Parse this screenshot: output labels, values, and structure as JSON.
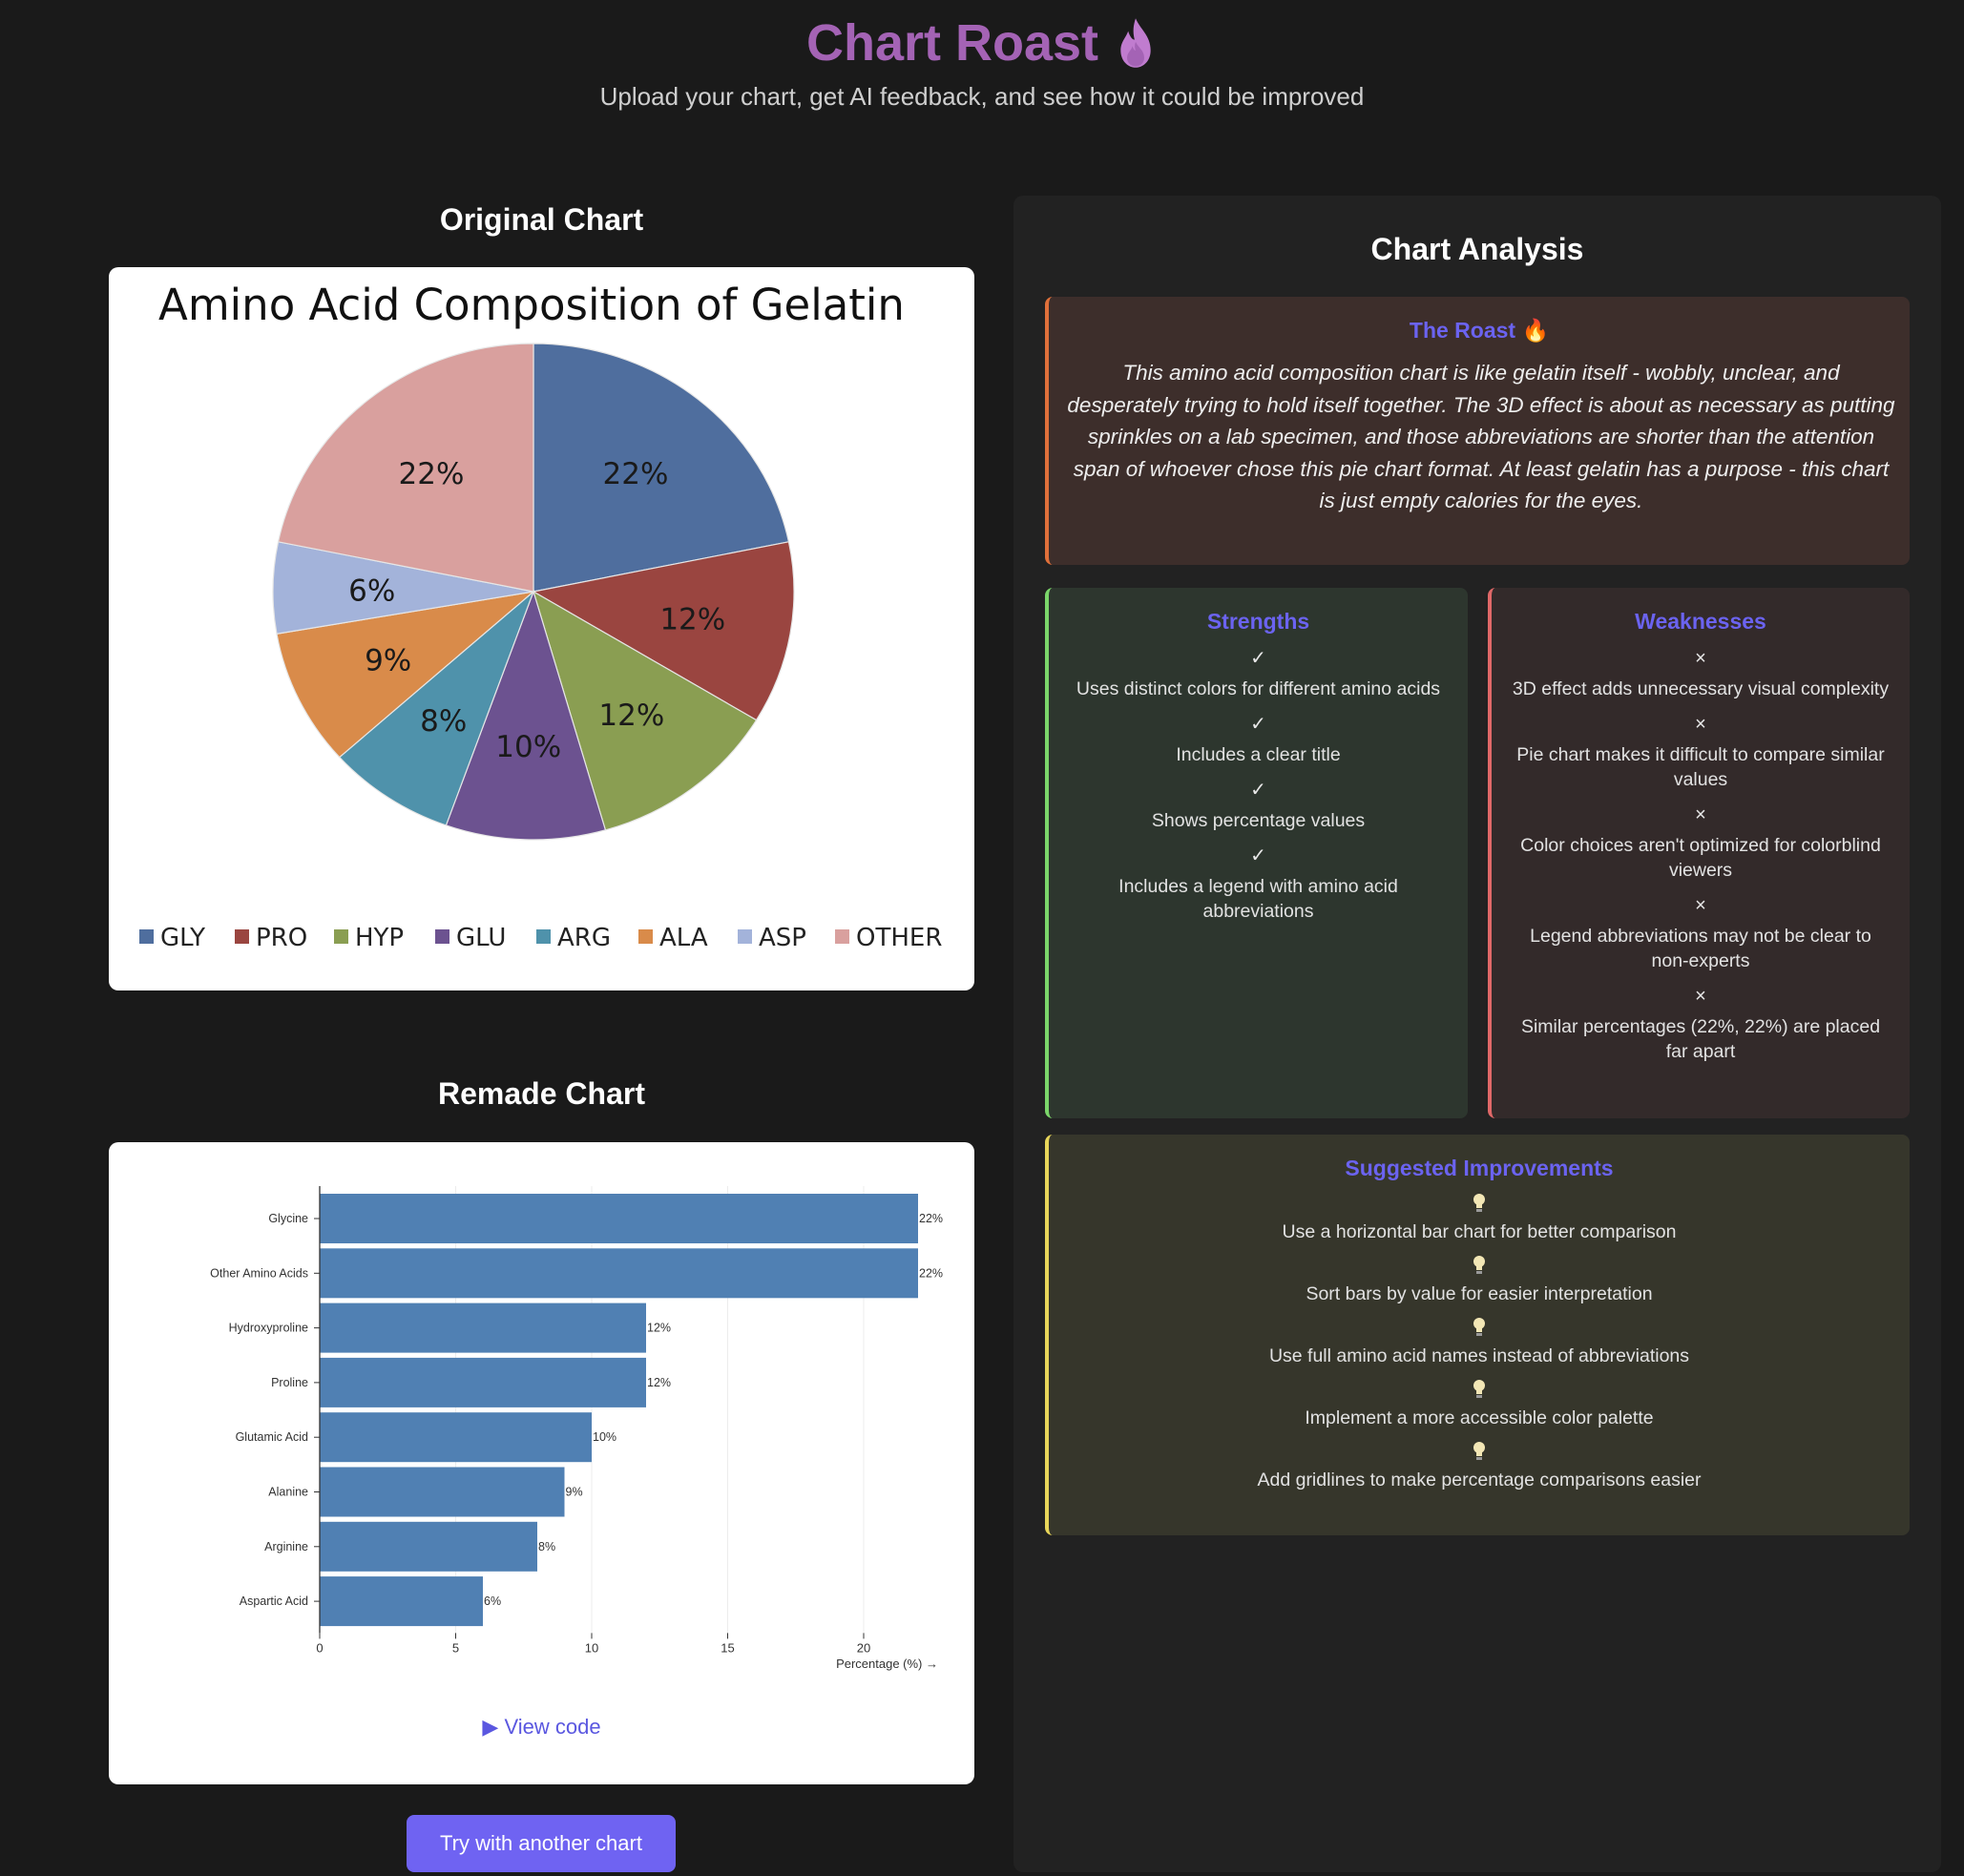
{
  "header": {
    "title": "Chart Roast",
    "subtitle": "Upload your chart, get AI feedback, and see how it could be improved"
  },
  "original": {
    "section_title": "Original Chart",
    "chart_title": "Amino Acid Composition of Gelatin",
    "legend": [
      "GLY",
      "PRO",
      "HYP",
      "GLU",
      "ARG",
      "ALA",
      "ASP",
      "OTHER"
    ]
  },
  "remade": {
    "section_title": "Remade Chart",
    "view_code": "▶ View code",
    "xlabel": "Percentage (%) →"
  },
  "try_button": "Try with another chart",
  "analysis": {
    "title": "Chart Analysis",
    "roast_title": "The Roast 🔥",
    "roast_text": "This amino acid composition chart is like gelatin itself - wobbly, unclear, and desperately trying to hold itself together. The 3D effect is about as necessary as putting sprinkles on a lab specimen, and those abbreviations are shorter than the attention span of whoever chose this pie chart format. At least gelatin has a purpose - this chart is just empty calories for the eyes.",
    "strengths_title": "Strengths",
    "strength_mark": "✓",
    "strengths": [
      "Uses distinct colors for different amino acids",
      "Includes a clear title",
      "Shows percentage values",
      "Includes a legend with amino acid abbreviations"
    ],
    "weaknesses_title": "Weaknesses",
    "weakness_mark": "×",
    "weaknesses": [
      "3D effect adds unnecessary visual complexity",
      "Pie chart makes it difficult to compare similar values",
      "Color choices aren't optimized for colorblind viewers",
      "Legend abbreviations may not be clear to non-experts",
      "Similar percentages (22%, 22%) are placed far apart"
    ],
    "improvements_title": "Suggested Improvements",
    "improvements": [
      "Use a horizontal bar chart for better comparison",
      "Sort bars by value for easier interpretation",
      "Use full amino acid names instead of abbreviations",
      "Implement a more accessible color palette",
      "Add gridlines to make percentage comparisons easier"
    ]
  },
  "colors": {
    "accent": "#6f63f2",
    "title": "#a463b5",
    "bar": "#5080b3"
  },
  "chart_data": [
    {
      "type": "pie",
      "title": "Amino Acid Composition of Gelatin",
      "categories": [
        "GLY",
        "PRO",
        "HYP",
        "GLU",
        "ARG",
        "ALA",
        "ASP",
        "OTHER"
      ],
      "values": [
        22,
        12,
        12,
        10,
        8,
        9,
        6,
        22
      ],
      "labels": [
        "22%",
        "12%",
        "12%",
        "10%",
        "8%",
        "9%",
        "6%",
        "22%"
      ],
      "colors": [
        "#4f6e9e",
        "#9a4540",
        "#8a9e52",
        "#6c5290",
        "#4f92ab",
        "#d98b4a",
        "#a3b3da",
        "#d9a09e"
      ],
      "legend": "bottom"
    },
    {
      "type": "bar",
      "orientation": "horizontal",
      "categories": [
        "Glycine",
        "Other Amino Acids",
        "Hydroxyproline",
        "Proline",
        "Glutamic Acid",
        "Alanine",
        "Arginine",
        "Aspartic Acid"
      ],
      "values": [
        22,
        22,
        12,
        12,
        10,
        9,
        8,
        6
      ],
      "labels": [
        "22%",
        "22%",
        "12%",
        "12%",
        "10%",
        "9%",
        "8%",
        "6%"
      ],
      "xlabel": "Percentage (%) →",
      "xlim": [
        0,
        22
      ],
      "xticks": [
        0,
        5,
        10,
        15,
        20
      ],
      "grid": true
    }
  ]
}
